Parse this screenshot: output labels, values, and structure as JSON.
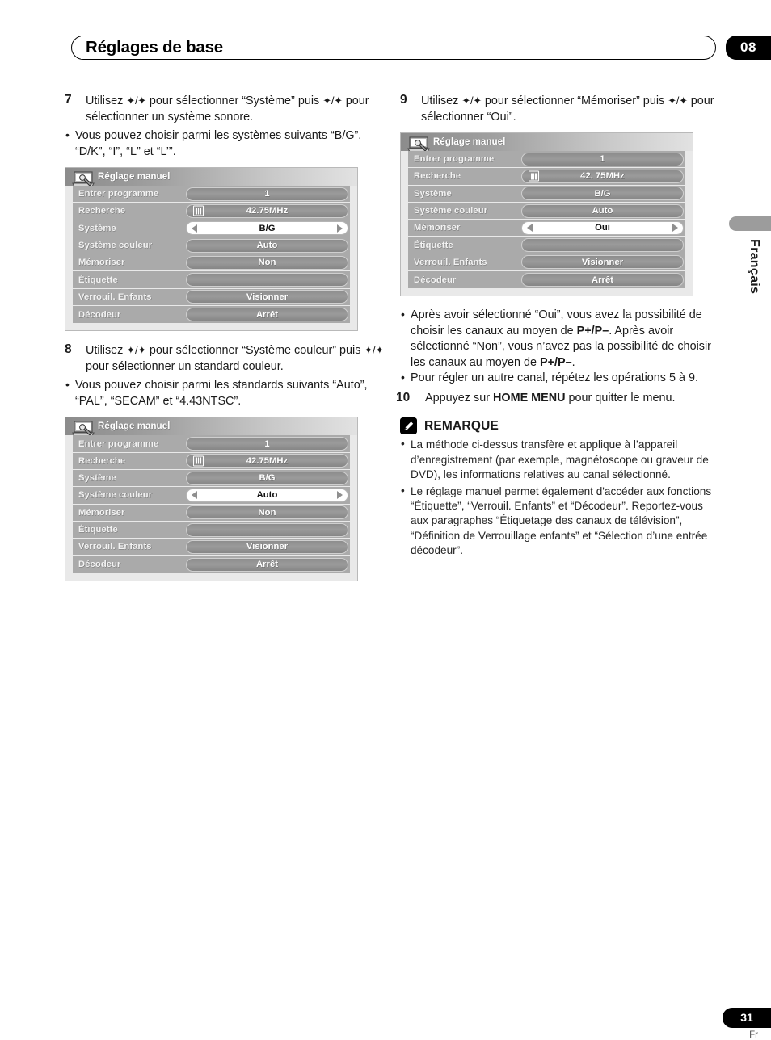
{
  "header": {
    "title": "Réglages de base",
    "chapter": "08"
  },
  "side_tab": {
    "language": "Français"
  },
  "footer": {
    "page_number": "31",
    "lang_code": "Fr"
  },
  "left_column": {
    "step7": {
      "number": "7",
      "line1_a": "Utilisez ",
      "line1_arrows": "✦/✦",
      "line1_b": " pour sélectionner “Système” puis",
      "line2_arrows": "✦/✦",
      "line2_b": " pour sélectionner un système sonore.",
      "bullet1": "Vous pouvez choisir parmi les systèmes suivants “B/G”, “D/K”, “I”, “L” et “L’”."
    },
    "step8": {
      "number": "8",
      "line1_a": "Utilisez ",
      "line1_arrows": "✦/✦",
      "line1_b": " pour sélectionner “Système couleur”",
      "line2_a": "puis ",
      "line2_arrows": "✦/✦",
      "line2_b": " pour sélectionner un standard couleur.",
      "bullet1": "Vous pouvez choisir parmi les standards suivants “Auto”, “PAL”, “SECAM” et “4.43NTSC”."
    }
  },
  "right_column": {
    "step9": {
      "number": "9",
      "line1_a": "Utilisez ",
      "line1_arrows": "✦/✦",
      "line1_b": " pour sélectionner “Mémoriser” puis",
      "line2_arrows": "✦/✦",
      "line2_b": " pour sélectionner “Oui”."
    },
    "bullets": {
      "b1_part1": "Après avoir sélectionné “Oui”, vous avez la possibilité de choisir les canaux au moyen de ",
      "b1_bold1": "P+/P–",
      "b1_part2": ". Après avoir sélectionné “Non”, vous n’avez pas la possibilité de choisir les canaux au moyen de ",
      "b1_bold2": "P+/P–",
      "b1_part3": ".",
      "b2": "Pour régler un autre canal, répétez les opérations 5 à 9."
    },
    "step10": {
      "number": "10",
      "text_a": "Appuyez sur ",
      "text_bold": "HOME MENU",
      "text_b": " pour quitter le menu."
    },
    "remarque": {
      "title": "REMARQUE",
      "note1": "La méthode ci-dessus transfère et applique à l’appareil d’enregistrement (par exemple, magnétoscope ou graveur de DVD), les informations relatives au canal sélectionné.",
      "note2": "Le réglage manuel permet également d'accéder aux fonctions “Étiquette”, “Verrouil. Enfants” et “Décodeur”. Reportez-vous aux paragraphes “Étiquetage des canaux de télévision”, “Définition de Verrouillage enfants” et “Sélection d’une entrée décodeur”."
    }
  },
  "osd_menus": [
    {
      "id": "menu-step7",
      "title": "Réglage manuel",
      "rows": [
        {
          "label": "Entrer programme",
          "value": "1",
          "selected": false,
          "icon": "none"
        },
        {
          "label": "Recherche",
          "value": "42.75MHz",
          "selected": false,
          "icon": "tuner"
        },
        {
          "label": "Système",
          "value": "B/G",
          "selected": true,
          "icon": "none"
        },
        {
          "label": "Système couleur",
          "value": "Auto",
          "selected": false,
          "icon": "none"
        },
        {
          "label": "Mémoriser",
          "value": "Non",
          "selected": false,
          "icon": "none"
        },
        {
          "label": "Étiquette",
          "value": "",
          "selected": false,
          "icon": "none"
        },
        {
          "label": "Verrouil. Enfants",
          "value": "Visionner",
          "selected": false,
          "icon": "none"
        },
        {
          "label": "Décodeur",
          "value": "Arrêt",
          "selected": false,
          "icon": "none"
        }
      ]
    },
    {
      "id": "menu-step8",
      "title": "Réglage manuel",
      "rows": [
        {
          "label": "Entrer programme",
          "value": "1",
          "selected": false,
          "icon": "none"
        },
        {
          "label": "Recherche",
          "value": "42.75MHz",
          "selected": false,
          "icon": "tuner"
        },
        {
          "label": "Système",
          "value": "B/G",
          "selected": false,
          "icon": "none"
        },
        {
          "label": "Système couleur",
          "value": "Auto",
          "selected": true,
          "icon": "none"
        },
        {
          "label": "Mémoriser",
          "value": "Non",
          "selected": false,
          "icon": "none"
        },
        {
          "label": "Étiquette",
          "value": "",
          "selected": false,
          "icon": "none"
        },
        {
          "label": "Verrouil. Enfants",
          "value": "Visionner",
          "selected": false,
          "icon": "none"
        },
        {
          "label": "Décodeur",
          "value": "Arrêt",
          "selected": false,
          "icon": "none"
        }
      ]
    },
    {
      "id": "menu-step9",
      "title": "Réglage manuel",
      "rows": [
        {
          "label": "Entrer programme",
          "value": "1",
          "selected": false,
          "icon": "none"
        },
        {
          "label": "Recherche",
          "value": "42. 75MHz",
          "selected": false,
          "icon": "tuner"
        },
        {
          "label": "Système",
          "value": "B/G",
          "selected": false,
          "icon": "none"
        },
        {
          "label": "Système couleur",
          "value": "Auto",
          "selected": false,
          "icon": "none"
        },
        {
          "label": "Mémoriser",
          "value": "Oui",
          "selected": true,
          "icon": "none"
        },
        {
          "label": "Étiquette",
          "value": "",
          "selected": false,
          "icon": "none"
        },
        {
          "label": "Verrouil. Enfants",
          "value": "Visionner",
          "selected": false,
          "icon": "none"
        },
        {
          "label": "Décodeur",
          "value": "Arrêt",
          "selected": false,
          "icon": "none"
        }
      ]
    }
  ]
}
